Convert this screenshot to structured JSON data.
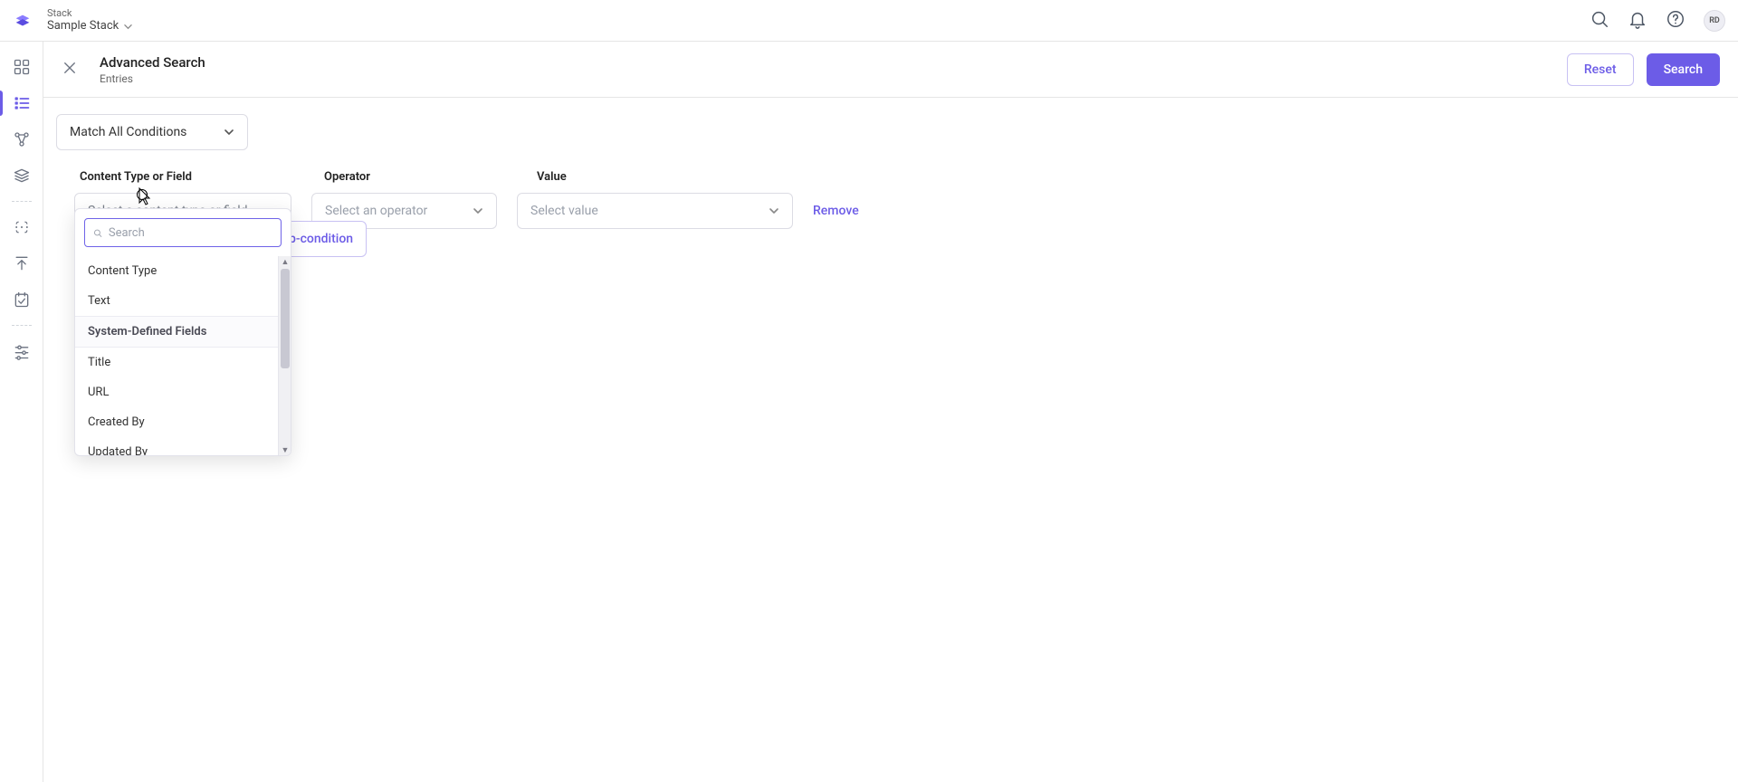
{
  "header": {
    "stack_label": "Stack",
    "stack_name": "Sample Stack",
    "avatar_initials": "RD"
  },
  "page": {
    "title": "Advanced Search",
    "subtitle": "Entries",
    "reset_label": "Reset",
    "search_label": "Search"
  },
  "match_conditions": {
    "label": "Match All Conditions"
  },
  "columns": {
    "content_type": "Content Type or Field",
    "operator": "Operator",
    "value": "Value"
  },
  "condition": {
    "content_type_placeholder": "Select a content type or field",
    "operator_placeholder": "Select an operator",
    "value_placeholder": "Select value",
    "remove_label": "Remove"
  },
  "subcondition_button": {
    "visible_text": "b-condition"
  },
  "dropdown": {
    "search_placeholder": "Search",
    "items": {
      "content_type": "Content Type",
      "text": "Text",
      "section_system": "System-Defined Fields",
      "title": "Title",
      "url": "URL",
      "created_by": "Created By",
      "updated_by": "Updated By"
    }
  }
}
